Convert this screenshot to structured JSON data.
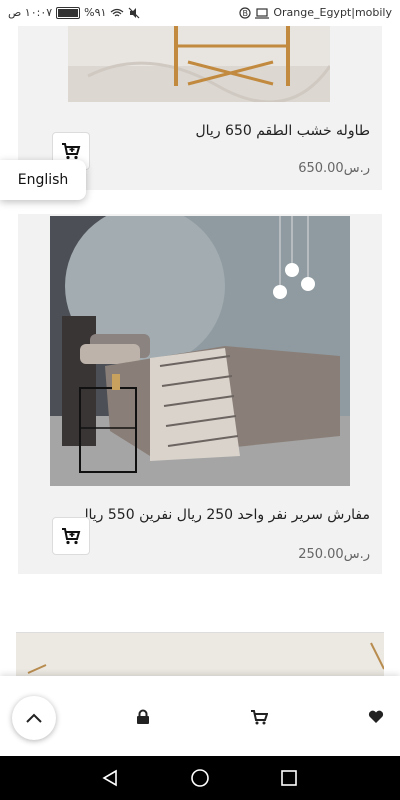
{
  "status_bar": {
    "time": "١٠:٠٧ ص",
    "battery": "%٩١",
    "carrier": "Orange_Egypt|mobily",
    "battery_level": 0.91
  },
  "language_toggle": {
    "label": "English"
  },
  "products": [
    {
      "title": "طاوله خشب الطقم 650 ريال",
      "price": "650.00ر.س"
    },
    {
      "title": "مفارش سرير نفر واحد 250 ريال نفرين 550 ريال",
      "price": "250.00ر.س"
    }
  ],
  "bottom_nav": {
    "icons": [
      "chevron-up-icon",
      "lock-icon",
      "cart-icon",
      "heart-icon"
    ]
  },
  "system_nav": {
    "icons": [
      "back-icon",
      "home-icon",
      "recents-icon"
    ]
  },
  "colors": {
    "card_bg": "#f2f2f2",
    "text": "#222222",
    "price": "#666666"
  }
}
